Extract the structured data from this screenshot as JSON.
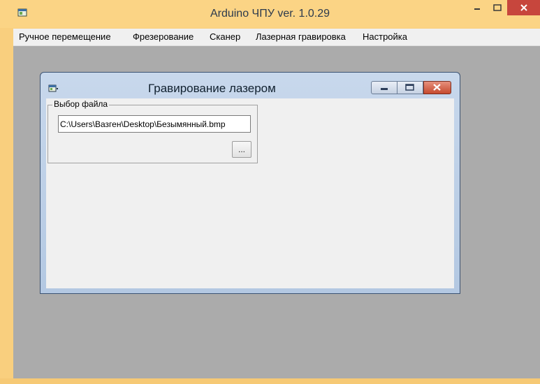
{
  "app": {
    "title": "Arduino ЧПУ   ver. 1.0.29"
  },
  "menu": [
    {
      "label": "Ручное перемещение"
    },
    {
      "label": "Фрезерование"
    },
    {
      "label": "Сканер"
    },
    {
      "label": "Лазерная гравировка"
    },
    {
      "label": "Настройка"
    }
  ],
  "dialog": {
    "title": "Гравирование лазером",
    "file_group": {
      "label": "Выбор файла",
      "path_value": "C:\\Users\\Вазген\\Desktop\\Безымянный.bmp",
      "browse_label": "..."
    }
  },
  "colors": {
    "window_frame": "#f9cf7e",
    "client_bg": "#ababab",
    "close_button": "#c7463d"
  },
  "icons": {
    "app": "app-window-icon",
    "minimize": "minimize-icon",
    "maximize": "maximize-icon",
    "close": "close-icon"
  }
}
